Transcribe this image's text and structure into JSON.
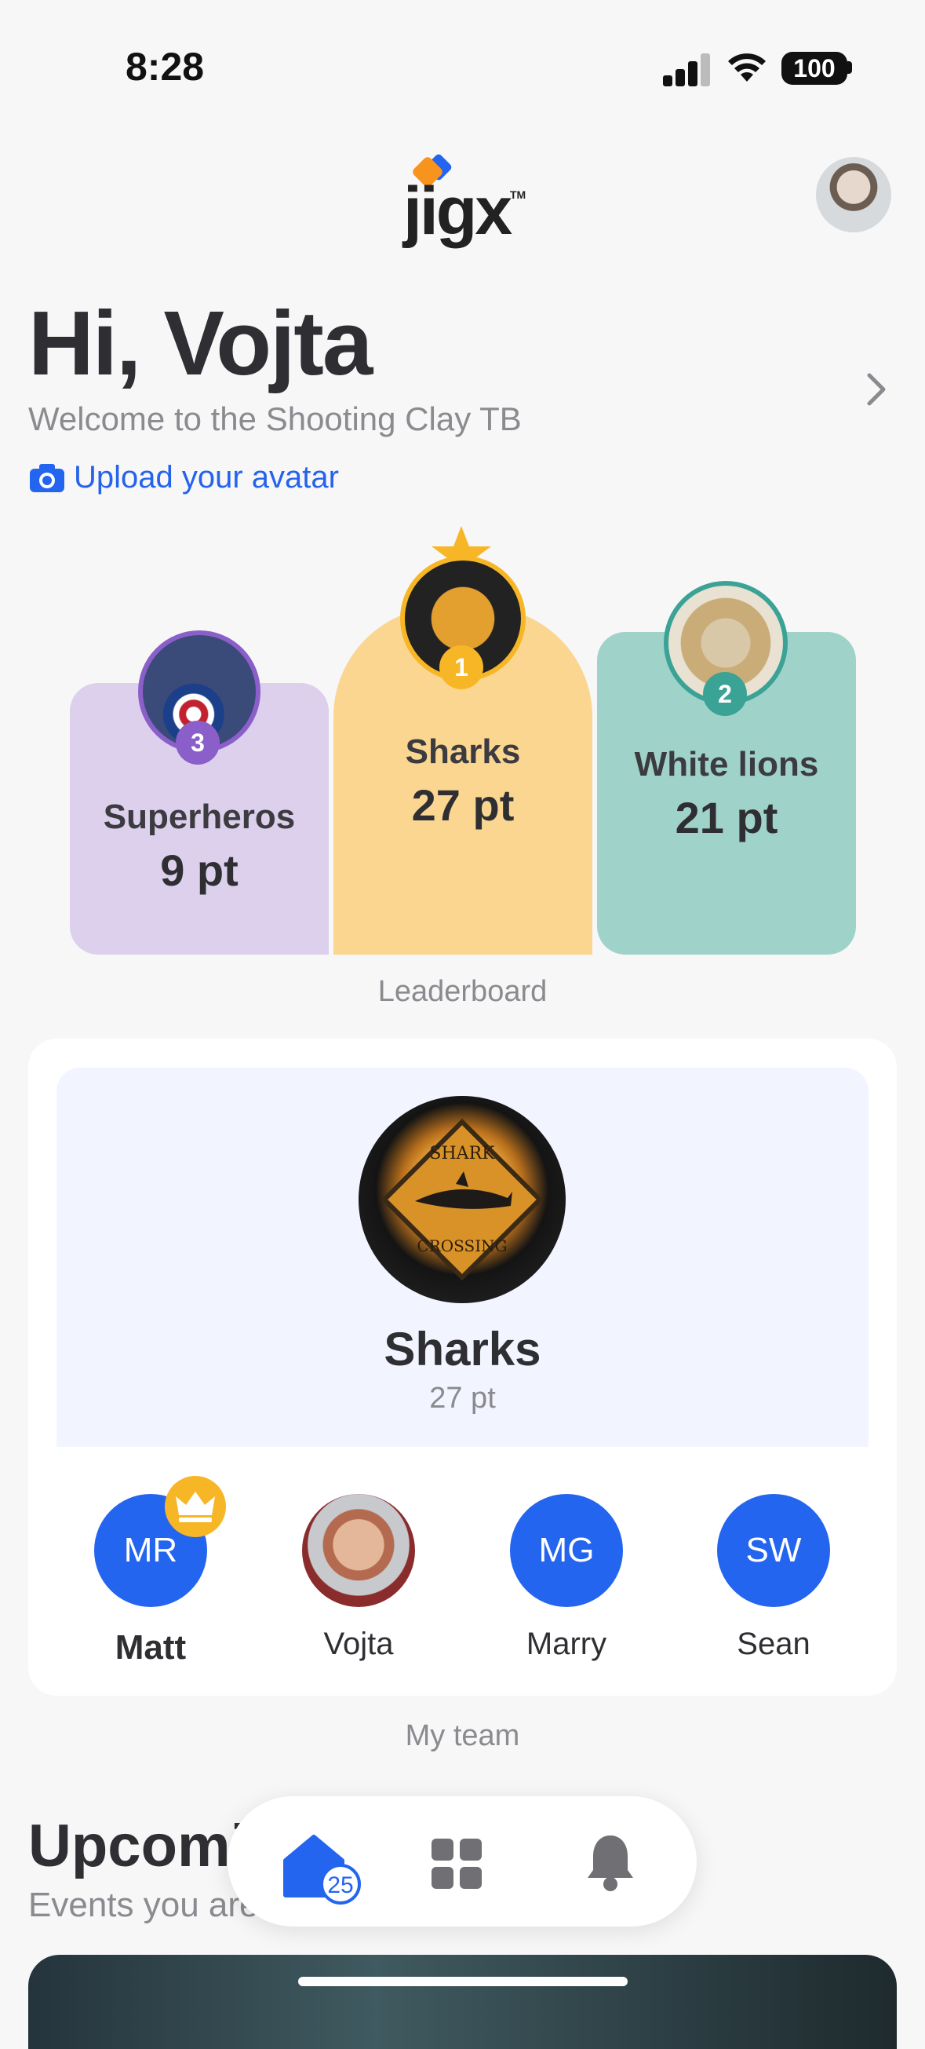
{
  "status_bar": {
    "time": "8:28",
    "battery": "100"
  },
  "header": {
    "logo_text": "jigx",
    "logo_tm": "TM"
  },
  "greeting": {
    "title": "Hi, Vojta",
    "subtitle": "Welcome to the Shooting Clay TB",
    "upload_label": "Upload your avatar"
  },
  "leaderboard": {
    "caption": "Leaderboard",
    "teams": [
      {
        "rank": "1",
        "name": "Sharks",
        "points": "27 pt"
      },
      {
        "rank": "2",
        "name": "White lions",
        "points": "21 pt"
      },
      {
        "rank": "3",
        "name": "Superheros",
        "points": "9 pt"
      }
    ]
  },
  "my_team": {
    "caption": "My team",
    "name": "Sharks",
    "points": "27 pt",
    "avatar_text_top": "SHARK",
    "avatar_text_bottom": "CROSSING",
    "members": [
      {
        "initials": "MR",
        "name": "Matt",
        "leader": true
      },
      {
        "initials": "",
        "name": "Vojta",
        "leader": false
      },
      {
        "initials": "MG",
        "name": "Marry",
        "leader": false
      },
      {
        "initials": "SW",
        "name": "Sean",
        "leader": false
      }
    ]
  },
  "upcoming": {
    "title": "Upcoming",
    "subtitle": "Events you are"
  },
  "bottom_nav": {
    "home_badge": "25"
  },
  "colors": {
    "accent": "#2465f0",
    "gold": "#f7b626",
    "purple": "#8b5fc9",
    "teal": "#3aa396"
  }
}
